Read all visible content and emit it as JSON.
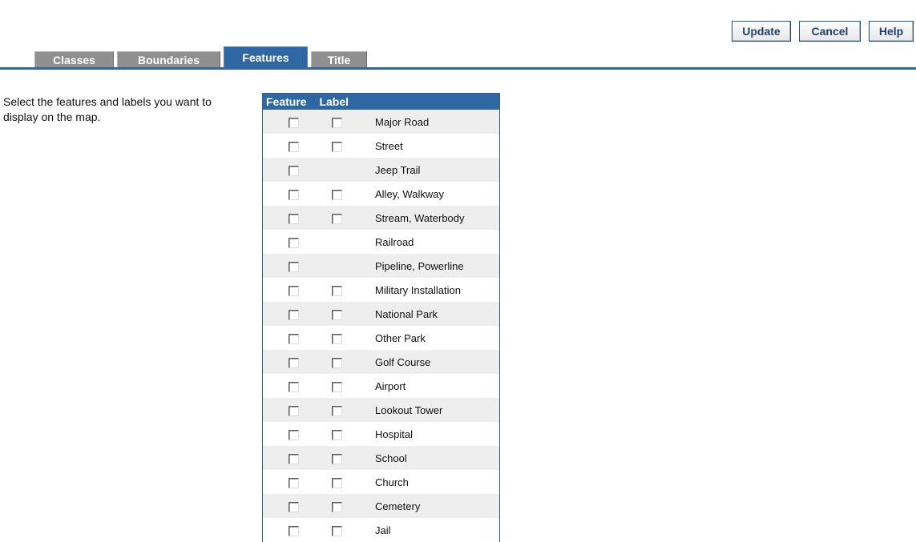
{
  "buttons": {
    "update": "Update",
    "cancel": "Cancel",
    "help": "Help"
  },
  "tabs": [
    {
      "label": "Classes",
      "selected": false
    },
    {
      "label": "Boundaries",
      "selected": false
    },
    {
      "label": "Features",
      "selected": true
    },
    {
      "label": "Title",
      "selected": false
    }
  ],
  "instructions": "Select the features and labels you want to display on the map.",
  "table": {
    "headers": {
      "feature": "Feature",
      "label": "Label"
    },
    "rows": [
      {
        "name": "Major Road",
        "feature_checked": false,
        "has_label": true,
        "label_checked": false
      },
      {
        "name": "Street",
        "feature_checked": false,
        "has_label": true,
        "label_checked": false
      },
      {
        "name": "Jeep Trail",
        "feature_checked": false,
        "has_label": false,
        "label_checked": false
      },
      {
        "name": "Alley, Walkway",
        "feature_checked": false,
        "has_label": true,
        "label_checked": false
      },
      {
        "name": "Stream, Waterbody",
        "feature_checked": false,
        "has_label": true,
        "label_checked": false
      },
      {
        "name": "Railroad",
        "feature_checked": false,
        "has_label": false,
        "label_checked": false
      },
      {
        "name": "Pipeline, Powerline",
        "feature_checked": false,
        "has_label": false,
        "label_checked": false
      },
      {
        "name": "Military Installation",
        "feature_checked": false,
        "has_label": true,
        "label_checked": false
      },
      {
        "name": "National Park",
        "feature_checked": false,
        "has_label": true,
        "label_checked": false
      },
      {
        "name": "Other Park",
        "feature_checked": false,
        "has_label": true,
        "label_checked": false
      },
      {
        "name": "Golf Course",
        "feature_checked": false,
        "has_label": true,
        "label_checked": false
      },
      {
        "name": "Airport",
        "feature_checked": false,
        "has_label": true,
        "label_checked": false
      },
      {
        "name": "Lookout Tower",
        "feature_checked": false,
        "has_label": true,
        "label_checked": false
      },
      {
        "name": "Hospital",
        "feature_checked": false,
        "has_label": true,
        "label_checked": false
      },
      {
        "name": "School",
        "feature_checked": false,
        "has_label": true,
        "label_checked": false
      },
      {
        "name": "Church",
        "feature_checked": false,
        "has_label": true,
        "label_checked": false
      },
      {
        "name": "Cemetery",
        "feature_checked": false,
        "has_label": true,
        "label_checked": false
      },
      {
        "name": "Jail",
        "feature_checked": false,
        "has_label": true,
        "label_checked": false
      }
    ]
  },
  "colors": {
    "accent": "#2f67a3",
    "tab_inactive": "#8f8f8f",
    "row_alt": "#eeeeee",
    "button_text": "#1e3f6b"
  }
}
